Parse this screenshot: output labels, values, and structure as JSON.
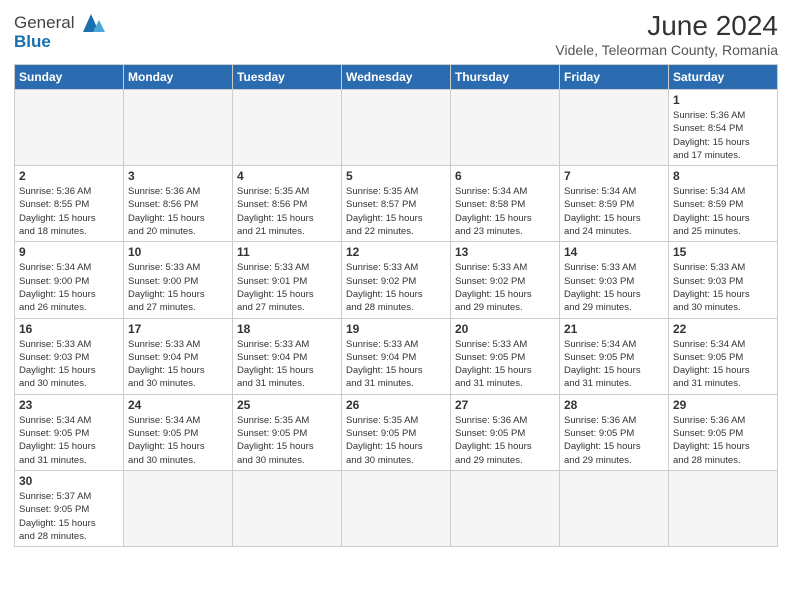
{
  "header": {
    "logo_general": "General",
    "logo_blue": "Blue",
    "month_year": "June 2024",
    "location": "Videle, Teleorman County, Romania"
  },
  "days_of_week": [
    "Sunday",
    "Monday",
    "Tuesday",
    "Wednesday",
    "Thursday",
    "Friday",
    "Saturday"
  ],
  "weeks": [
    [
      {
        "day": "",
        "info": ""
      },
      {
        "day": "",
        "info": ""
      },
      {
        "day": "",
        "info": ""
      },
      {
        "day": "",
        "info": ""
      },
      {
        "day": "",
        "info": ""
      },
      {
        "day": "",
        "info": ""
      },
      {
        "day": "1",
        "info": "Sunrise: 5:36 AM\nSunset: 8:54 PM\nDaylight: 15 hours\nand 17 minutes."
      }
    ],
    [
      {
        "day": "2",
        "info": "Sunrise: 5:36 AM\nSunset: 8:55 PM\nDaylight: 15 hours\nand 18 minutes."
      },
      {
        "day": "3",
        "info": "Sunrise: 5:36 AM\nSunset: 8:56 PM\nDaylight: 15 hours\nand 20 minutes."
      },
      {
        "day": "4",
        "info": "Sunrise: 5:35 AM\nSunset: 8:56 PM\nDaylight: 15 hours\nand 21 minutes."
      },
      {
        "day": "5",
        "info": "Sunrise: 5:35 AM\nSunset: 8:57 PM\nDaylight: 15 hours\nand 22 minutes."
      },
      {
        "day": "6",
        "info": "Sunrise: 5:34 AM\nSunset: 8:58 PM\nDaylight: 15 hours\nand 23 minutes."
      },
      {
        "day": "7",
        "info": "Sunrise: 5:34 AM\nSunset: 8:59 PM\nDaylight: 15 hours\nand 24 minutes."
      },
      {
        "day": "8",
        "info": "Sunrise: 5:34 AM\nSunset: 8:59 PM\nDaylight: 15 hours\nand 25 minutes."
      }
    ],
    [
      {
        "day": "9",
        "info": "Sunrise: 5:34 AM\nSunset: 9:00 PM\nDaylight: 15 hours\nand 26 minutes."
      },
      {
        "day": "10",
        "info": "Sunrise: 5:33 AM\nSunset: 9:00 PM\nDaylight: 15 hours\nand 27 minutes."
      },
      {
        "day": "11",
        "info": "Sunrise: 5:33 AM\nSunset: 9:01 PM\nDaylight: 15 hours\nand 27 minutes."
      },
      {
        "day": "12",
        "info": "Sunrise: 5:33 AM\nSunset: 9:02 PM\nDaylight: 15 hours\nand 28 minutes."
      },
      {
        "day": "13",
        "info": "Sunrise: 5:33 AM\nSunset: 9:02 PM\nDaylight: 15 hours\nand 29 minutes."
      },
      {
        "day": "14",
        "info": "Sunrise: 5:33 AM\nSunset: 9:03 PM\nDaylight: 15 hours\nand 29 minutes."
      },
      {
        "day": "15",
        "info": "Sunrise: 5:33 AM\nSunset: 9:03 PM\nDaylight: 15 hours\nand 30 minutes."
      }
    ],
    [
      {
        "day": "16",
        "info": "Sunrise: 5:33 AM\nSunset: 9:03 PM\nDaylight: 15 hours\nand 30 minutes."
      },
      {
        "day": "17",
        "info": "Sunrise: 5:33 AM\nSunset: 9:04 PM\nDaylight: 15 hours\nand 30 minutes."
      },
      {
        "day": "18",
        "info": "Sunrise: 5:33 AM\nSunset: 9:04 PM\nDaylight: 15 hours\nand 31 minutes."
      },
      {
        "day": "19",
        "info": "Sunrise: 5:33 AM\nSunset: 9:04 PM\nDaylight: 15 hours\nand 31 minutes."
      },
      {
        "day": "20",
        "info": "Sunrise: 5:33 AM\nSunset: 9:05 PM\nDaylight: 15 hours\nand 31 minutes."
      },
      {
        "day": "21",
        "info": "Sunrise: 5:34 AM\nSunset: 9:05 PM\nDaylight: 15 hours\nand 31 minutes."
      },
      {
        "day": "22",
        "info": "Sunrise: 5:34 AM\nSunset: 9:05 PM\nDaylight: 15 hours\nand 31 minutes."
      }
    ],
    [
      {
        "day": "23",
        "info": "Sunrise: 5:34 AM\nSunset: 9:05 PM\nDaylight: 15 hours\nand 31 minutes."
      },
      {
        "day": "24",
        "info": "Sunrise: 5:34 AM\nSunset: 9:05 PM\nDaylight: 15 hours\nand 30 minutes."
      },
      {
        "day": "25",
        "info": "Sunrise: 5:35 AM\nSunset: 9:05 PM\nDaylight: 15 hours\nand 30 minutes."
      },
      {
        "day": "26",
        "info": "Sunrise: 5:35 AM\nSunset: 9:05 PM\nDaylight: 15 hours\nand 30 minutes."
      },
      {
        "day": "27",
        "info": "Sunrise: 5:36 AM\nSunset: 9:05 PM\nDaylight: 15 hours\nand 29 minutes."
      },
      {
        "day": "28",
        "info": "Sunrise: 5:36 AM\nSunset: 9:05 PM\nDaylight: 15 hours\nand 29 minutes."
      },
      {
        "day": "29",
        "info": "Sunrise: 5:36 AM\nSunset: 9:05 PM\nDaylight: 15 hours\nand 28 minutes."
      }
    ],
    [
      {
        "day": "30",
        "info": "Sunrise: 5:37 AM\nSunset: 9:05 PM\nDaylight: 15 hours\nand 28 minutes."
      },
      {
        "day": "",
        "info": ""
      },
      {
        "day": "",
        "info": ""
      },
      {
        "day": "",
        "info": ""
      },
      {
        "day": "",
        "info": ""
      },
      {
        "day": "",
        "info": ""
      },
      {
        "day": "",
        "info": ""
      }
    ]
  ]
}
